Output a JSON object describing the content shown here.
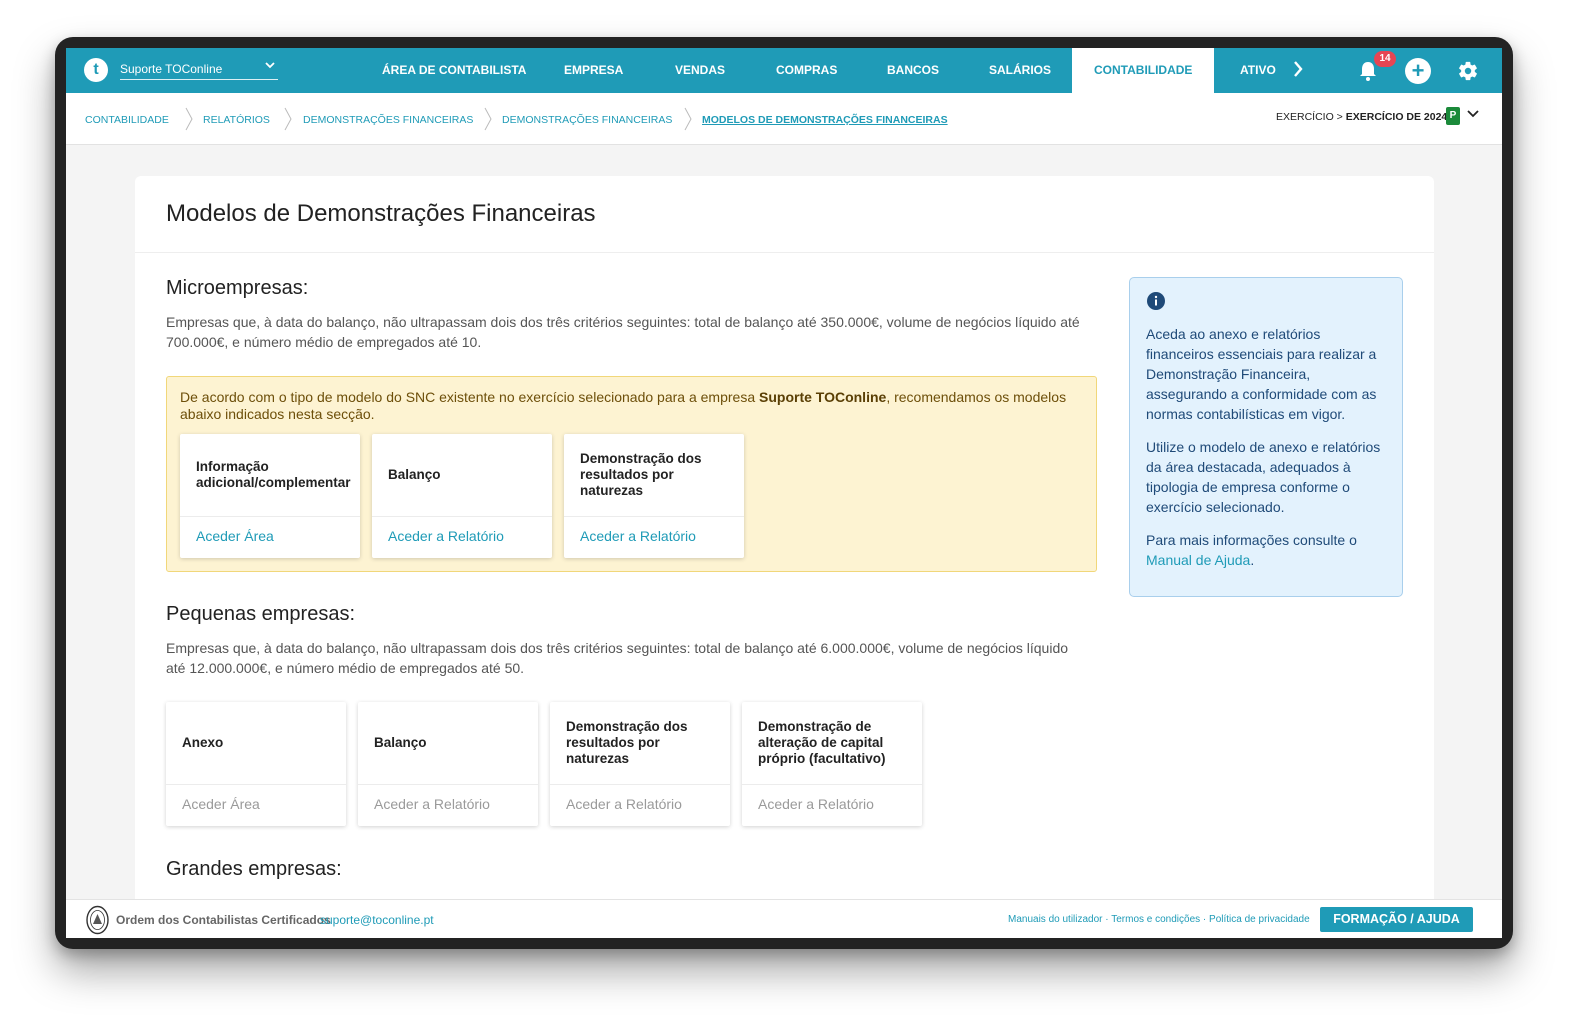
{
  "header": {
    "logo_letter": "t",
    "company": "Suporte TOConline",
    "nav": [
      "ÁREA DE CONTABILISTA",
      "EMPRESA",
      "VENDAS",
      "COMPRAS",
      "BANCOS",
      "SALÁRIOS",
      "CONTABILIDADE",
      "ATIVO"
    ],
    "active_nav": "CONTABILIDADE",
    "notification_count": "14"
  },
  "breadcrumb": [
    "CONTABILIDADE",
    "RELATÓRIOS",
    "DEMONSTRAÇÕES FINANCEIRAS",
    "DEMONSTRAÇÕES FINANCEIRAS",
    "MODELOS DE DEMONSTRAÇÕES FINANCEIRAS"
  ],
  "exercise": {
    "label": "EXERCÍCIO > ",
    "value": "EXERCÍCIO DE 2024",
    "badge": "P"
  },
  "page": {
    "title": "Modelos de Demonstrações Financeiras",
    "micro": {
      "heading": "Microempresas:",
      "description": "Empresas que, à data do balanço, não ultrapassam dois dos três critérios seguintes: total de balanço até 350.000€, volume de negócios líquido até 700.000€, e número médio de empregados até 10.",
      "reco_prefix": "De acordo com o tipo de modelo do SNC existente no exercício selecionado para a empresa ",
      "reco_company": "Suporte TOConline",
      "reco_suffix": ", recomendamos os modelos abaixo indicados nesta secção.",
      "tiles": [
        {
          "title": "Informação adicional/complementar",
          "link": "Aceder Área"
        },
        {
          "title": "Balanço",
          "link": "Aceder a Relatório"
        },
        {
          "title": "Demonstração dos resultados por naturezas",
          "link": "Aceder a Relatório"
        }
      ]
    },
    "small": {
      "heading": "Pequenas empresas:",
      "description": "Empresas que, à data do balanço, não ultrapassam dois dos três critérios seguintes: total de balanço até 6.000.000€, volume de negócios líquido até 12.000.000€, e número médio de empregados até 50.",
      "tiles": [
        {
          "title": "Anexo",
          "link": "Aceder Área"
        },
        {
          "title": "Balanço",
          "link": "Aceder a Relatório"
        },
        {
          "title": "Demonstração dos resultados por naturezas",
          "link": "Aceder a Relatório"
        },
        {
          "title": "Demonstração de alteração de capital próprio (facultativo)",
          "link": "Aceder a Relatório"
        }
      ]
    },
    "large": {
      "heading": "Grandes empresas:"
    },
    "info": {
      "p1": "Aceda ao anexo e relatórios financeiros essenciais para realizar a Demonstração Financeira, assegurando a conformidade com as normas contabilísticas em vigor.",
      "p2": "Utilize o modelo de anexo e relatórios da área destacada, adequados à tipologia de empresa conforme o exercício selecionado.",
      "p3_prefix": "Para mais informações consulte o ",
      "p3_link": "Manual de Ajuda",
      "p3_suffix": "."
    }
  },
  "footer": {
    "org": "Ordem dos Contabilistas Certificados",
    "email": "suporte@toconline.pt",
    "links": [
      "Manuais do utilizador",
      "Termos e condições",
      "Política de privacidade"
    ],
    "help_button": "FORMAÇÃO / AJUDA"
  },
  "colors": {
    "brand": "#1f9bb7",
    "recommendation_bg": "#fdf3d2",
    "info_bg": "#e3f2fd",
    "badge_red": "#e64553",
    "exercise_green": "#1b8a3a"
  },
  "icons": [
    "chevron-down-icon",
    "chevron-right-icon",
    "bell-icon",
    "plus-icon",
    "gear-icon",
    "info-icon",
    "occ-seal-icon"
  ]
}
